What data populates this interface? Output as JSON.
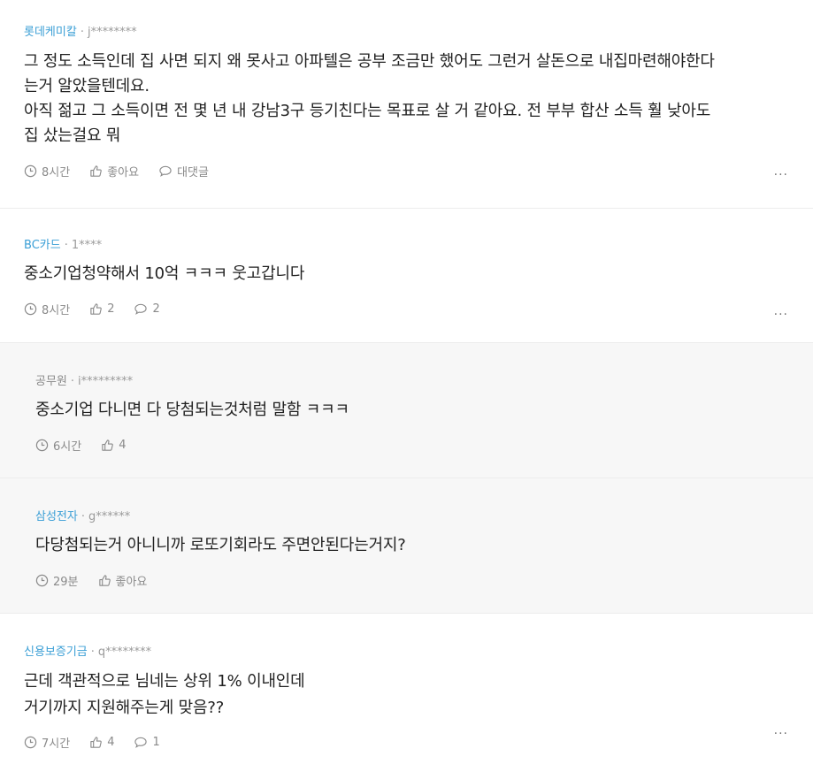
{
  "comments": [
    {
      "company": "롯데케미칼",
      "user": "j********",
      "lines": [
        "그 정도 소득인데 집 사면 되지 왜 못사고 아파텔은 공부 조금만 했어도 그런거 살돈으로 내집마련해야한다",
        "는거 알았을텐데요.",
        "아직 젊고 그 소득이면 전 몇 년 내 강남3구 등기친다는 목표로 살 거 같아요. 전 부부 합산 소득 훨 낮아도",
        "집 샀는걸요 뭐"
      ],
      "time": "8시간",
      "like": "좋아요",
      "reply": "대댓글",
      "more": "···"
    },
    {
      "company": "BC카드",
      "user": "1****",
      "lines": [
        "중소기업청약해서 10억 ㅋㅋㅋ 웃고갑니다"
      ],
      "time": "8시간",
      "like": "2",
      "reply": "2",
      "more": "···"
    },
    {
      "company": "공무원",
      "user": "i*********",
      "lines": [
        "중소기업 다니면 다 당첨되는것처럼 말함 ㅋㅋㅋ"
      ],
      "time": "6시간",
      "like": "4"
    },
    {
      "company": "삼성전자",
      "user": "g******",
      "lines": [
        "다당첨되는거 아니니까 로또기회라도 주면안된다는거지?"
      ],
      "time": "29분",
      "like": "좋아요"
    },
    {
      "company": "신용보증기금",
      "user": "q********",
      "lines": [
        "근데 객관적으로 님네는 상위 1% 이내인데",
        "거기까지 지원해주는게 맞음??"
      ],
      "time": "7시간",
      "like": "4",
      "reply": "1",
      "more": "···"
    }
  ],
  "separator": "·"
}
